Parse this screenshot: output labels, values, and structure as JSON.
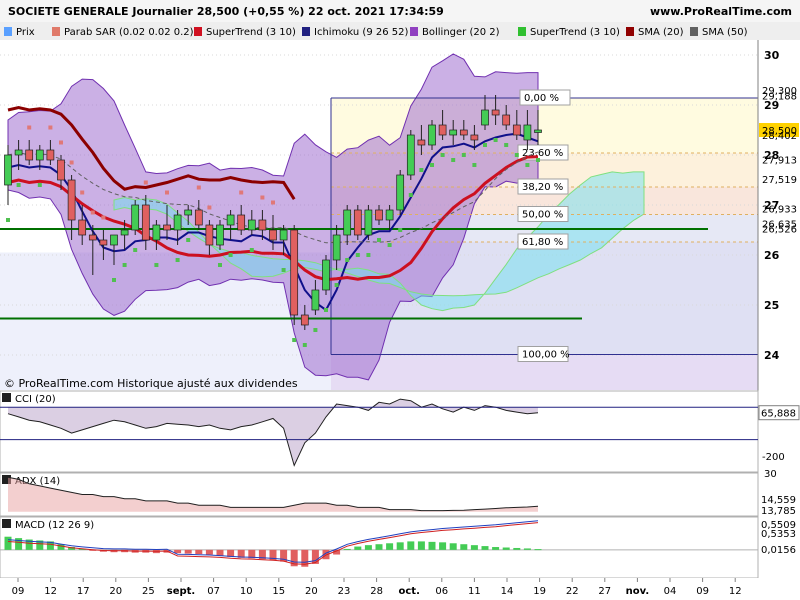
{
  "header": {
    "title": "SOCIETE GENERALE Journalier 28,500 (+0,55 %) 22 oct. 2021 17:34:59",
    "site": "www.ProRealTime.com"
  },
  "legend_bar": [
    {
      "label": "Prix",
      "color": "#5aa0ff"
    },
    {
      "label": "Parab SAR (0.02 0.02 0.2)",
      "color": "#e07a6a"
    },
    {
      "label": "SuperTrend (3 10)",
      "color": "#d01020"
    },
    {
      "label": "Ichimoku (9 26 52)",
      "color": "#202080"
    },
    {
      "label": "Bollinger (20 2)",
      "color": "#9040c0"
    },
    {
      "label": "SuperTrend (3 10)",
      "color": "#30c030"
    },
    {
      "label": "SMA (20)",
      "color": "#900000"
    },
    {
      "label": "SMA (50)",
      "color": "#606060"
    }
  ],
  "copyright": "© ProRealTime.com Historique ajusté aux dividendes",
  "colors": {
    "up": "#44cc55",
    "down": "#e06060",
    "bollinger": "#a070d0",
    "boll_line": "#7030b0",
    "kumo_green": "#7fe07f",
    "kumo_cyan": "#6fe0f0",
    "sma20": "#8b0000",
    "supertrend_red": "#cc1020",
    "kijun": "#10108a",
    "sar": "#e07878",
    "sar_green": "#50c050",
    "support": "#007000"
  },
  "chart_data": [
    {
      "type": "candlestick",
      "title": "SOCIETE GENERALE Journalier",
      "ylim": [
        23.3,
        30.3
      ],
      "y_ticks": [
        24,
        25,
        26,
        27,
        28,
        29,
        30
      ],
      "x_labels": [
        "09",
        "12",
        "17",
        "20",
        "25",
        "sept.",
        "07",
        "10",
        "15",
        "20",
        "23",
        "28",
        "oct.",
        "06",
        "11",
        "14",
        "19",
        "22",
        "27",
        "nov.",
        "04",
        "09",
        "12"
      ],
      "candles": [
        {
          "o": 27.4,
          "h": 28.2,
          "l": 27.0,
          "c": 28.0
        },
        {
          "o": 28.0,
          "h": 28.3,
          "l": 27.7,
          "c": 28.1
        },
        {
          "o": 28.1,
          "h": 28.3,
          "l": 27.8,
          "c": 27.9
        },
        {
          "o": 27.9,
          "h": 28.2,
          "l": 27.7,
          "c": 28.1
        },
        {
          "o": 28.1,
          "h": 28.3,
          "l": 27.8,
          "c": 27.9
        },
        {
          "o": 27.9,
          "h": 28.0,
          "l": 27.3,
          "c": 27.5
        },
        {
          "o": 27.5,
          "h": 27.6,
          "l": 26.3,
          "c": 26.7
        },
        {
          "o": 26.7,
          "h": 27.0,
          "l": 26.2,
          "c": 26.4
        },
        {
          "o": 26.4,
          "h": 26.6,
          "l": 25.6,
          "c": 26.3
        },
        {
          "o": 26.3,
          "h": 26.5,
          "l": 25.9,
          "c": 26.2
        },
        {
          "o": 26.2,
          "h": 26.4,
          "l": 25.8,
          "c": 26.4
        },
        {
          "o": 26.4,
          "h": 26.7,
          "l": 26.1,
          "c": 26.5
        },
        {
          "o": 26.5,
          "h": 27.1,
          "l": 26.4,
          "c": 27.0
        },
        {
          "o": 27.0,
          "h": 27.2,
          "l": 26.1,
          "c": 26.3
        },
        {
          "o": 26.3,
          "h": 26.7,
          "l": 26.1,
          "c": 26.6
        },
        {
          "o": 26.6,
          "h": 27.0,
          "l": 26.3,
          "c": 26.5
        },
        {
          "o": 26.5,
          "h": 26.9,
          "l": 26.2,
          "c": 26.8
        },
        {
          "o": 26.8,
          "h": 27.0,
          "l": 26.6,
          "c": 26.9
        },
        {
          "o": 26.9,
          "h": 27.1,
          "l": 26.5,
          "c": 26.6
        },
        {
          "o": 26.6,
          "h": 26.7,
          "l": 26.0,
          "c": 26.2
        },
        {
          "o": 26.2,
          "h": 26.7,
          "l": 26.1,
          "c": 26.6
        },
        {
          "o": 26.6,
          "h": 26.9,
          "l": 26.3,
          "c": 26.8
        },
        {
          "o": 26.8,
          "h": 27.0,
          "l": 26.4,
          "c": 26.5
        },
        {
          "o": 26.5,
          "h": 26.9,
          "l": 26.4,
          "c": 26.7
        },
        {
          "o": 26.7,
          "h": 26.9,
          "l": 26.3,
          "c": 26.5
        },
        {
          "o": 26.5,
          "h": 26.8,
          "l": 26.1,
          "c": 26.3
        },
        {
          "o": 26.3,
          "h": 26.6,
          "l": 26.0,
          "c": 26.5
        },
        {
          "o": 26.5,
          "h": 26.6,
          "l": 24.6,
          "c": 24.8
        },
        {
          "o": 24.8,
          "h": 25.0,
          "l": 24.5,
          "c": 24.6
        },
        {
          "o": 24.9,
          "h": 25.5,
          "l": 24.8,
          "c": 25.3
        },
        {
          "o": 25.3,
          "h": 26.0,
          "l": 25.2,
          "c": 25.9
        },
        {
          "o": 25.9,
          "h": 26.6,
          "l": 25.7,
          "c": 26.4
        },
        {
          "o": 26.4,
          "h": 27.0,
          "l": 26.2,
          "c": 26.9
        },
        {
          "o": 26.9,
          "h": 27.0,
          "l": 26.3,
          "c": 26.4
        },
        {
          "o": 26.4,
          "h": 27.0,
          "l": 26.3,
          "c": 26.9
        },
        {
          "o": 26.9,
          "h": 27.0,
          "l": 26.6,
          "c": 26.7
        },
        {
          "o": 26.7,
          "h": 27.0,
          "l": 26.5,
          "c": 26.9
        },
        {
          "o": 26.9,
          "h": 27.7,
          "l": 26.8,
          "c": 27.6
        },
        {
          "o": 27.6,
          "h": 28.5,
          "l": 27.5,
          "c": 28.4
        },
        {
          "o": 28.3,
          "h": 28.6,
          "l": 28.0,
          "c": 28.2
        },
        {
          "o": 28.2,
          "h": 28.7,
          "l": 28.1,
          "c": 28.6
        },
        {
          "o": 28.6,
          "h": 28.9,
          "l": 28.3,
          "c": 28.4
        },
        {
          "o": 28.4,
          "h": 28.7,
          "l": 28.2,
          "c": 28.5
        },
        {
          "o": 28.5,
          "h": 28.7,
          "l": 28.3,
          "c": 28.4
        },
        {
          "o": 28.4,
          "h": 28.6,
          "l": 28.1,
          "c": 28.3
        },
        {
          "o": 28.6,
          "h": 29.2,
          "l": 28.5,
          "c": 28.9
        },
        {
          "o": 28.9,
          "h": 29.2,
          "l": 28.6,
          "c": 28.8
        },
        {
          "o": 28.8,
          "h": 29.0,
          "l": 28.5,
          "c": 28.6
        },
        {
          "o": 28.6,
          "h": 28.9,
          "l": 28.3,
          "c": 28.4
        },
        {
          "o": 28.3,
          "h": 28.9,
          "l": 28.1,
          "c": 28.6
        },
        {
          "o": 28.45,
          "h": 28.9,
          "l": 28.2,
          "c": 28.5
        }
      ],
      "price_labels": [
        {
          "value": "29,300",
          "y": 29.3,
          "color": "#9040c0"
        },
        {
          "value": "29,188",
          "y": 29.188,
          "color": "#d01020"
        },
        {
          "value": "28,500",
          "y": 28.5,
          "color": "#000000",
          "bg": "#ffd200"
        },
        {
          "value": "28,402",
          "y": 28.402,
          "color": "#202080"
        },
        {
          "value": "27,913",
          "y": 27.913,
          "color": "#606060"
        },
        {
          "value": "27,519",
          "y": 27.519,
          "color": "#2a90d0"
        },
        {
          "value": "26,933",
          "y": 26.933,
          "color": "#007000"
        },
        {
          "value": "26,635",
          "y": 26.635,
          "color": "#e06060"
        },
        {
          "value": "26,526",
          "y": 26.526,
          "color": "#9040c0"
        }
      ],
      "fibonacci": [
        {
          "label": "0,00 %",
          "value": 29.14
        },
        {
          "label": "23,60 %",
          "value": 28.04
        },
        {
          "label": "38,20 %",
          "value": 27.36
        },
        {
          "label": "50,00 %",
          "value": 26.81
        },
        {
          "label": "61,80 %",
          "value": 26.26
        },
        {
          "label": "100,00 %",
          "value": 24.01
        }
      ],
      "support_lines": [
        26.52,
        24.73
      ]
    },
    {
      "type": "line",
      "title": "CCI (20)",
      "ylim": [
        -300,
        200
      ],
      "y_ticks": [
        -200
      ],
      "last_value": "65,888",
      "values": [
        60,
        40,
        20,
        10,
        -10,
        -30,
        -60,
        -40,
        -20,
        0,
        20,
        10,
        -10,
        -30,
        -20,
        0,
        -5,
        -10,
        -20,
        -10,
        -30,
        -40,
        -20,
        -10,
        10,
        30,
        -30,
        -260,
        -120,
        -60,
        40,
        120,
        110,
        100,
        80,
        130,
        120,
        150,
        140,
        100,
        120,
        90,
        70,
        100,
        80,
        110,
        100,
        80,
        70,
        60,
        66
      ]
    },
    {
      "type": "line",
      "title": "ADX (14)",
      "ylim": [
        10,
        30
      ],
      "y_ticks": [
        30
      ],
      "last_values": [
        "14,559",
        "13,785"
      ],
      "values": [
        28,
        27,
        25,
        24,
        23,
        22,
        21,
        20,
        20,
        19,
        19,
        18,
        18,
        17,
        17,
        17,
        16,
        16,
        15,
        15,
        15,
        14,
        14,
        14,
        14,
        14,
        14,
        15,
        16,
        16,
        16,
        15,
        15,
        14,
        14,
        14,
        13,
        13,
        13,
        12.5,
        12.5,
        12.5,
        12.6,
        12.7,
        13,
        13.2,
        13.5,
        13.8,
        14,
        14.2,
        14.559
      ]
    },
    {
      "type": "bar",
      "title": "MACD (12 26 9)",
      "ylim": [
        -0.6,
        0.7
      ],
      "last_values": [
        "0,5509",
        "0,5353",
        "0,0156"
      ],
      "histogram": [
        0.28,
        0.25,
        0.22,
        0.2,
        0.18,
        0.12,
        0.06,
        0.02,
        -0.01,
        -0.04,
        -0.05,
        -0.05,
        -0.06,
        -0.06,
        -0.07,
        -0.06,
        -0.07,
        -0.08,
        -0.09,
        -0.1,
        -0.12,
        -0.15,
        -0.17,
        -0.18,
        -0.2,
        -0.22,
        -0.25,
        -0.35,
        -0.36,
        -0.3,
        -0.2,
        -0.1,
        0.02,
        0.07,
        0.1,
        0.12,
        0.14,
        0.16,
        0.18,
        0.18,
        0.17,
        0.16,
        0.14,
        0.12,
        0.1,
        0.08,
        0.06,
        0.05,
        0.04,
        0.03,
        0.016
      ]
    }
  ]
}
